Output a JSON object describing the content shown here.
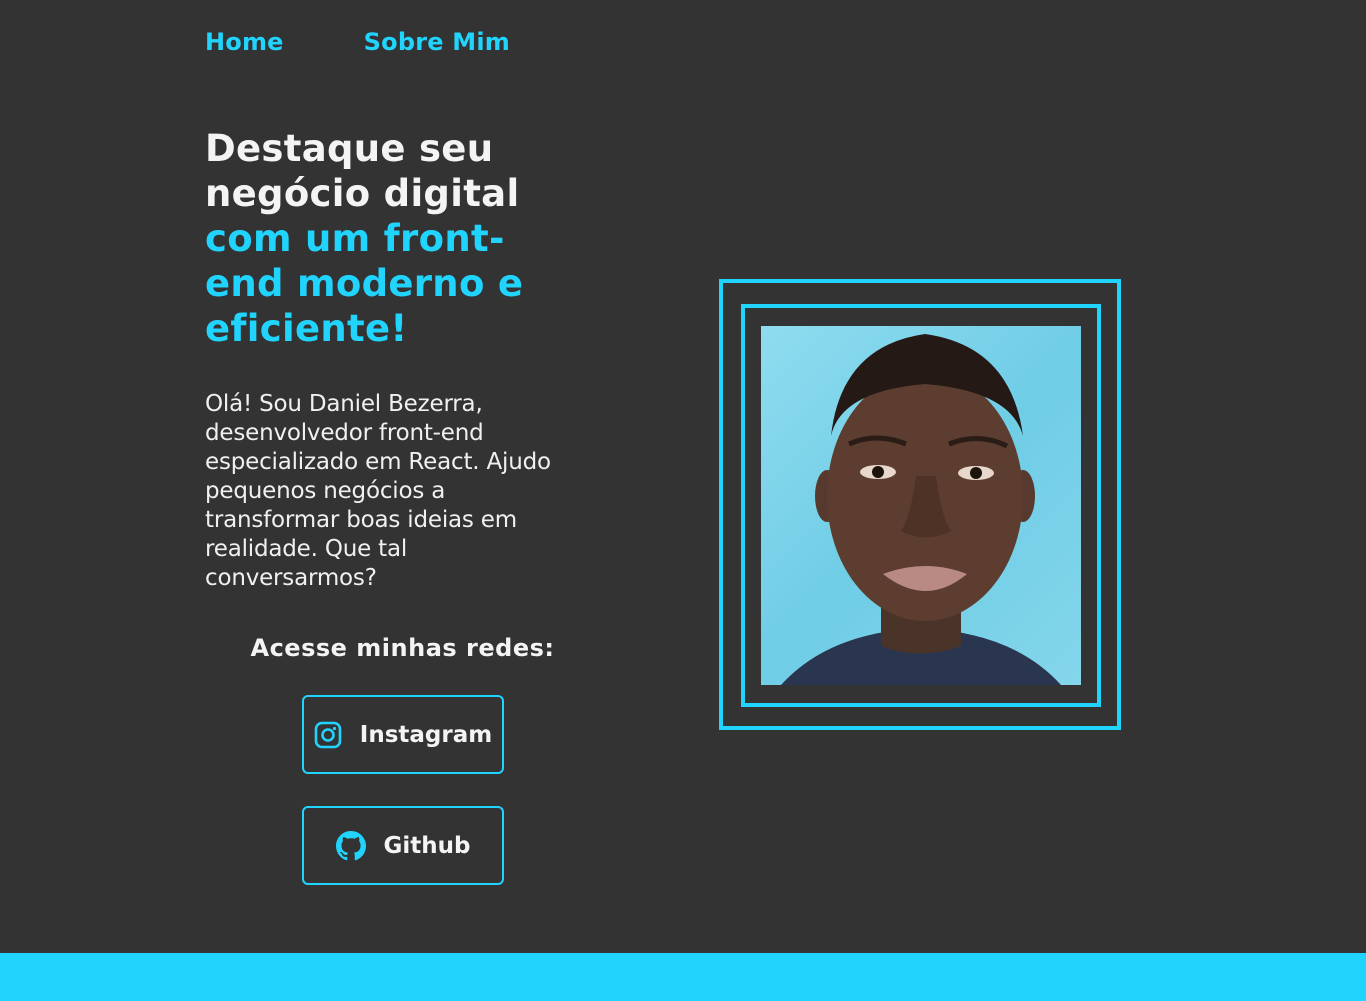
{
  "nav": {
    "items": [
      {
        "label": "Home"
      },
      {
        "label": "Sobre Mim"
      }
    ]
  },
  "hero": {
    "headline_lines_white": [
      "Destaque seu",
      "negócio digital"
    ],
    "headline_lines_cyan": [
      "com um front-",
      "end moderno e",
      "eficiente!"
    ],
    "intro": "Olá! Sou Daniel Bezerra, desenvolvedor front-end especializado em React. Ajudo pequenos negócios a transformar boas ideias em realidade. Que tal conversarmos?"
  },
  "social": {
    "title": "Acesse minhas redes:",
    "instagram": {
      "label": "Instagram",
      "icon": "instagram-icon"
    },
    "github": {
      "label": "Github",
      "icon": "github-icon"
    }
  },
  "colors": {
    "background": "#333333",
    "accent": "#21d4fd",
    "text": "#f4f4f4"
  }
}
